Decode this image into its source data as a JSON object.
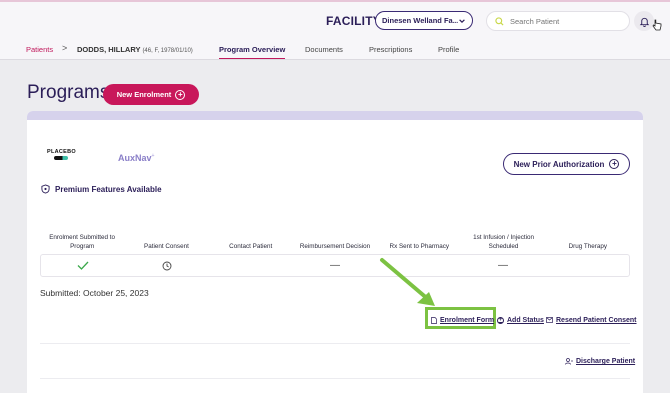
{
  "header": {
    "facility_label": "FACILITY",
    "facility_value": "Dinesen Welland Fa...",
    "search_placeholder": "Search Patient"
  },
  "breadcrumb": {
    "root": "Patients",
    "separator": ">",
    "patient_name": "DODDS, HILLARY",
    "patient_meta": "(46, F, 1978/01/10)"
  },
  "tabs": [
    {
      "label": "Program Overview",
      "active": true
    },
    {
      "label": "Documents",
      "active": false
    },
    {
      "label": "Prescriptions",
      "active": false
    },
    {
      "label": "Profile",
      "active": false
    }
  ],
  "page": {
    "title": "Programs",
    "new_enrolment_label": "New Enrolment"
  },
  "program_card": {
    "logo_placebo": "PLACEBO",
    "logo_auxnav": "AuxNav",
    "logo_auxnav_mark": "+",
    "premium_label": "Premium Features Available",
    "prior_auth_label": "New Prior Authorization",
    "steps": [
      {
        "label": "Enrolment Submitted to Program",
        "status": "check-icon"
      },
      {
        "label": "Patient Consent",
        "status": "clock-icon"
      },
      {
        "label": "Contact Patient",
        "status": ""
      },
      {
        "label": "Reimbursement Decision",
        "status": "—"
      },
      {
        "label": "Rx Sent to Pharmacy",
        "status": ""
      },
      {
        "label": "1st Infusion / Injection Scheduled",
        "status": "—"
      },
      {
        "label": "Drug Therapy",
        "status": ""
      }
    ],
    "submitted_text": "Submitted: October 25, 2023",
    "actions": {
      "enrolment_form": "Enrolment Form",
      "add_status": "Add Status",
      "resend_consent": "Resend Patient Consent"
    },
    "discharge_label": "Discharge Patient"
  },
  "colors": {
    "brand_purple": "#2b1e58",
    "accent_pink": "#c8175a",
    "highlight_green": "#7cc242",
    "check_green": "#3aa84a"
  }
}
